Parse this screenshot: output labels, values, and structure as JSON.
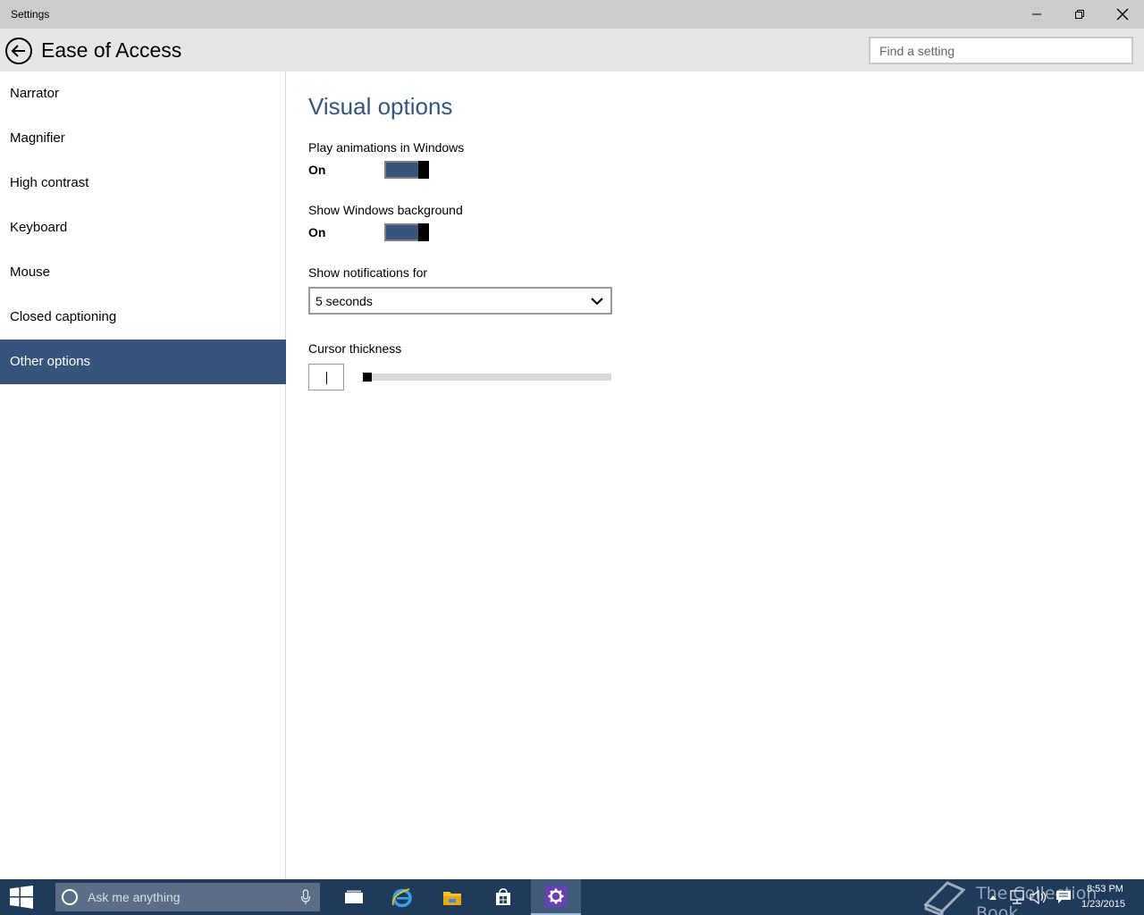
{
  "window": {
    "title": "Settings"
  },
  "header": {
    "title": "Ease of Access",
    "search_placeholder": "Find a setting"
  },
  "sidebar": {
    "items": [
      {
        "label": "Narrator",
        "active": false
      },
      {
        "label": "Magnifier",
        "active": false
      },
      {
        "label": "High contrast",
        "active": false
      },
      {
        "label": "Keyboard",
        "active": false
      },
      {
        "label": "Mouse",
        "active": false
      },
      {
        "label": "Closed captioning",
        "active": false
      },
      {
        "label": "Other options",
        "active": true
      }
    ]
  },
  "main": {
    "section_title": "Visual options",
    "animations": {
      "label": "Play animations in Windows",
      "state": "On",
      "on": true
    },
    "background": {
      "label": "Show Windows background",
      "state": "On",
      "on": true
    },
    "notifications": {
      "label": "Show notifications for",
      "value": "5 seconds"
    },
    "cursor": {
      "label": "Cursor thickness",
      "level": 1
    }
  },
  "taskbar": {
    "search_placeholder": "Ask me anything",
    "apps": [
      "task-view",
      "internet-explorer",
      "file-explorer",
      "store",
      "settings"
    ],
    "active_app": "settings",
    "time": "8:53 PM",
    "date": "1/23/2015",
    "watermark": "The Collection Book"
  },
  "colors": {
    "accent": "#36547c",
    "titlebar": "#cccccc",
    "header": "#e6e6e6",
    "taskbar": "#1f3a5a"
  }
}
